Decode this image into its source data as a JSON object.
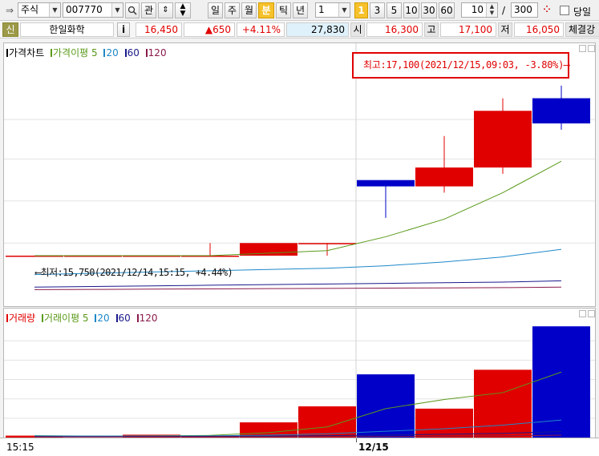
{
  "toolbar": {
    "market": "주식",
    "code": "007770",
    "gwan_label": "관",
    "period_buttons": [
      "일",
      "주",
      "월",
      "분",
      "틱",
      "년"
    ],
    "active_period": "분",
    "interval_value": "1",
    "interval_marker": "1",
    "interval_buttons": [
      "3",
      "5",
      "10",
      "30",
      "60"
    ],
    "zoom_value": "10",
    "slash": "/",
    "count_value": "300",
    "same_day_label": "당일"
  },
  "infobar": {
    "badge": "신",
    "name": "한일화학",
    "info_btn": "i",
    "price": "16,450",
    "change": "▲650",
    "change_pct": "+4.11%",
    "volume": "27,830",
    "open_label": "시",
    "open": "16,300",
    "high_label": "고",
    "high": "17,100",
    "low_label": "저",
    "low": "16,050",
    "exec_label": "체결강"
  },
  "price_panel": {
    "legend": [
      {
        "label": "가격차트",
        "color": "#000000"
      },
      {
        "label": "가격이평 5",
        "color": "#5a9a1a"
      },
      {
        "label": "20",
        "color": "#1e88c8"
      },
      {
        "label": "60",
        "color": "#1a1a8c"
      },
      {
        "label": "120",
        "color": "#8a1a4a"
      }
    ],
    "high_annotation": "최고:17,100(2021/12/15,09:03, -3.80%)⟶",
    "low_annotation": "⟵최저:15,750(2021/12/14,15:15, +4.44%)"
  },
  "volume_panel": {
    "legend": [
      {
        "label": "거래량",
        "color": "#e00000"
      },
      {
        "label": "거래이평 5",
        "color": "#5a9a1a"
      },
      {
        "label": "20",
        "color": "#1e88c8"
      },
      {
        "label": "60",
        "color": "#1a1a8c"
      },
      {
        "label": "120",
        "color": "#8a1a4a"
      }
    ]
  },
  "x_axis": {
    "left_label": "15:15",
    "date_label": "12/15"
  },
  "colors": {
    "up": "#e00000",
    "down": "#0000c8"
  },
  "chart_data": {
    "type": "candlestick",
    "price": {
      "candles": [
        {
          "open": 15750,
          "high": 15750,
          "low": 15750,
          "close": 15750
        },
        {
          "open": 15750,
          "high": 15750,
          "low": 15750,
          "close": 15750
        },
        {
          "open": 15750,
          "high": 15750,
          "low": 15750,
          "close": 15750
        },
        {
          "open": 15750,
          "high": 15850,
          "low": 15750,
          "close": 15750
        },
        {
          "open": 15750,
          "high": 15800,
          "low": 15750,
          "close": 15850
        },
        {
          "open": 15850,
          "high": 15850,
          "low": 15750,
          "close": 15850
        },
        {
          "open": 16350,
          "high": 16350,
          "low": 16050,
          "close": 16300
        },
        {
          "open": 16300,
          "high": 16700,
          "low": 16250,
          "close": 16450
        },
        {
          "open": 16450,
          "high": 17000,
          "low": 16400,
          "close": 16900
        },
        {
          "open": 17000,
          "high": 17100,
          "low": 16750,
          "close": 16800
        }
      ],
      "ma": {
        "5": [
          15750,
          15750,
          15750,
          15750,
          15770,
          15790,
          15900,
          16040,
          16250,
          16500
        ],
        "20": [
          15600,
          15610,
          15620,
          15630,
          15640,
          15650,
          15670,
          15700,
          15740,
          15800
        ],
        "60": [
          15500,
          15505,
          15510,
          15515,
          15520,
          15525,
          15530,
          15535,
          15540,
          15550
        ],
        "120": [
          15480,
          15482,
          15484,
          15486,
          15488,
          15490,
          15492,
          15494,
          15496,
          15500
        ]
      }
    },
    "volume": {
      "values": [
        120,
        40,
        160,
        90,
        700,
        1400,
        2800,
        1300,
        3000,
        4900
      ],
      "ma": {
        "5": [
          120,
          100,
          110,
          130,
          250,
          500,
          1300,
          1700,
          2000,
          2900
        ],
        "20": [
          110,
          100,
          100,
          110,
          140,
          200,
          310,
          420,
          580,
          800
        ],
        "60": [
          80,
          80,
          85,
          90,
          100,
          120,
          150,
          180,
          220,
          300
        ],
        "120": [
          60,
          62,
          64,
          66,
          70,
          75,
          80,
          90,
          110,
          140
        ]
      }
    }
  }
}
